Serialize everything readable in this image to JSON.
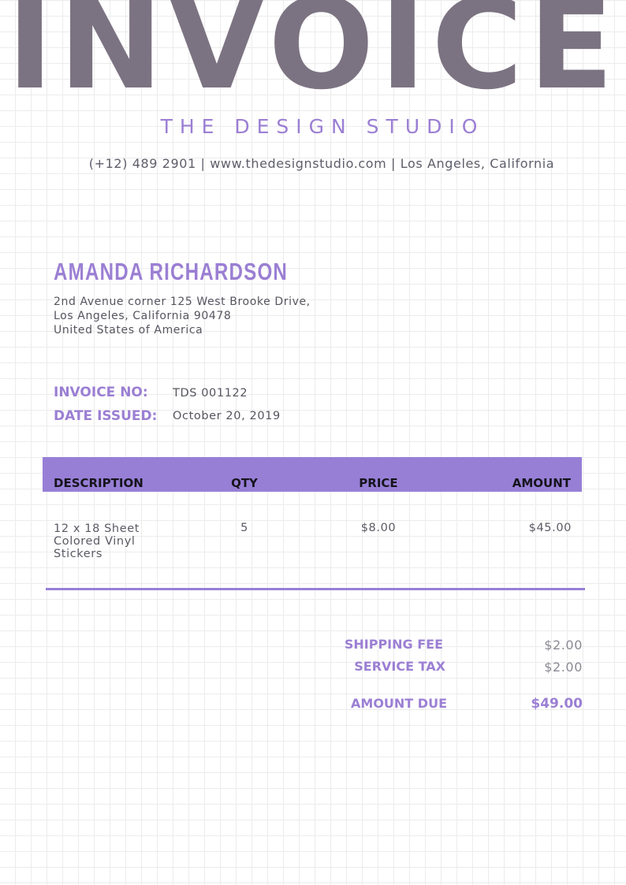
{
  "header": {
    "title": "INVOICE",
    "studio": "THE DESIGN STUDIO",
    "contact": "(+12) 489 2901  |  www.thedesignstudio.com  |  Los Angeles, California"
  },
  "client": {
    "name": "AMANDA RICHARDSON",
    "address": [
      "2nd Avenue corner 125 West Brooke Drive,",
      "Los Angeles, California 90478",
      "United States of America"
    ]
  },
  "meta": {
    "invoice_no_label": "INVOICE NO:",
    "invoice_no": "TDS 001122",
    "date_label": "DATE ISSUED:",
    "date": "October 20, 2019"
  },
  "table": {
    "headers": [
      "DESCRIPTION",
      "QTY",
      "PRICE",
      "AMOUNT"
    ],
    "rows": [
      {
        "description": "12 x 18 Sheet Colored Vinyl Stickers",
        "qty": "5",
        "price": "$8.00",
        "amount": "$45.00"
      }
    ]
  },
  "summary": {
    "shipping_label": "SHIPPING FEE",
    "shipping_value": "$2.00",
    "tax_label": "SERVICE TAX",
    "tax_value": "$2.00",
    "due_label": "AMOUNT DUE",
    "due_value": "$49.00"
  },
  "colors": {
    "accent": "#977fd6",
    "title": "#7c7382"
  }
}
